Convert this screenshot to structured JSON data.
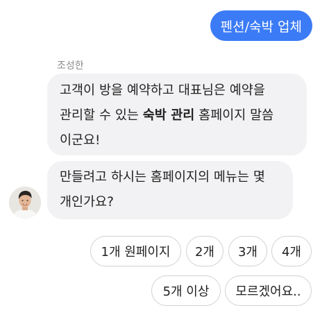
{
  "user_message": {
    "text": "펜션/숙박 업체"
  },
  "bot": {
    "sender_name": "조성한",
    "avatar_icon": "person-avatar-icon",
    "message_1": {
      "line_1": "고객이 방을 예약하고 대표님은 예약을",
      "line_2_prefix": "관리할 수 있는 ",
      "line_2_bold": "숙박 관리",
      "line_2_suffix": " 홈페이지 말씀",
      "line_3": "이군요!"
    },
    "message_2": {
      "line_1": "만들려고 하시는 홈페이지의 메뉴는 몇",
      "line_2": "개인가요?"
    }
  },
  "quick_replies": [
    "1개 원페이지",
    "2개",
    "3개",
    "4개",
    "5개 이상",
    "모르겠어요.."
  ],
  "colors": {
    "user_bubble": "#3b7bf6",
    "bot_bubble": "#f2f2f4",
    "chip_border": "#cfd1d6"
  }
}
